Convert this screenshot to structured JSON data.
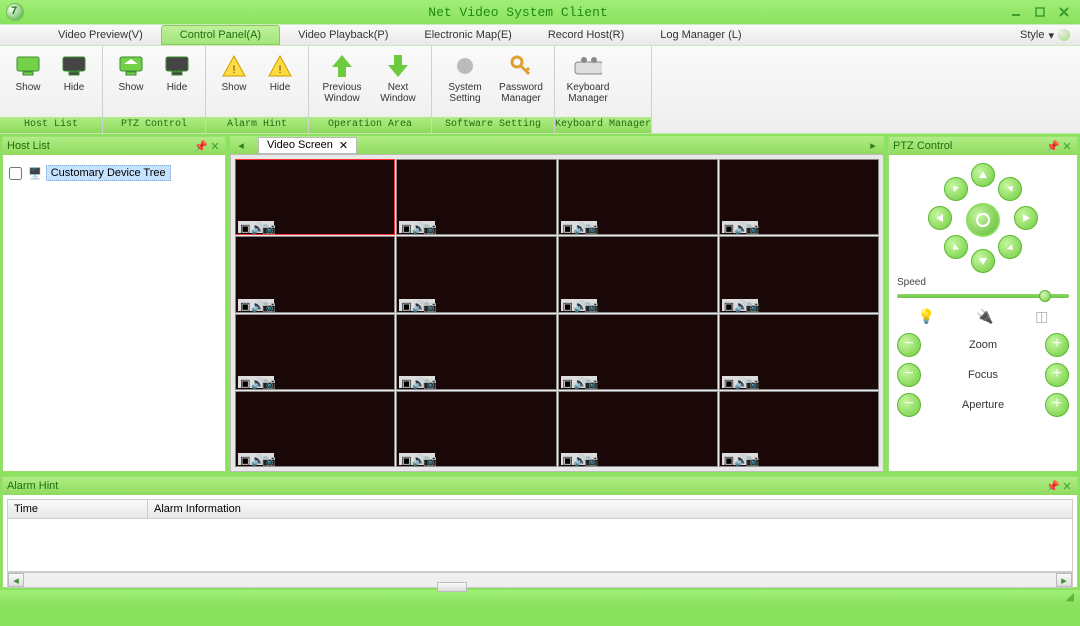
{
  "titlebar": {
    "title": "Net Video System Client"
  },
  "menu": {
    "tabs": [
      "Video Preview(V)",
      "Control Panel(A)",
      "Video Playback(P)",
      "Electronic Map(E)",
      "Record Host(R)",
      "Log Manager (L)"
    ],
    "active_index": 1,
    "style_label": "Style"
  },
  "ribbon": {
    "groups": [
      {
        "label": "Host List",
        "buttons": [
          {
            "name": "hostlist-show",
            "label": "Show",
            "icon": "monitor-green"
          },
          {
            "name": "hostlist-hide",
            "label": "Hide",
            "icon": "monitor-dark"
          }
        ]
      },
      {
        "label": "PTZ Control",
        "buttons": [
          {
            "name": "ptz-show",
            "label": "Show",
            "icon": "monitor-green-home"
          },
          {
            "name": "ptz-hide",
            "label": "Hide",
            "icon": "monitor-dark"
          }
        ]
      },
      {
        "label": "Alarm Hint",
        "buttons": [
          {
            "name": "alarm-show",
            "label": "Show",
            "icon": "warning"
          },
          {
            "name": "alarm-hide",
            "label": "Hide",
            "icon": "warning"
          }
        ]
      },
      {
        "label": "Operation Area",
        "buttons": [
          {
            "name": "prev-window",
            "label": "Previous Window",
            "icon": "arrow-up"
          },
          {
            "name": "next-window",
            "label": "Next Window",
            "icon": "arrow-down"
          }
        ]
      },
      {
        "label": "Software Setting",
        "buttons": [
          {
            "name": "system-setting",
            "label": "System Setting",
            "icon": "gear"
          },
          {
            "name": "password-manager",
            "label": "Password Manager",
            "icon": "key"
          }
        ]
      },
      {
        "label": "Keyboard Manager",
        "buttons": [
          {
            "name": "keyboard-manager",
            "label": "Keyboard Manager",
            "icon": "keyboard"
          }
        ]
      }
    ]
  },
  "hostlist": {
    "title": "Host List",
    "tree_root": "Customary Device Tree"
  },
  "center": {
    "tab_label": "Video Screen",
    "grid_rows": 4,
    "grid_cols": 4,
    "selected_cell": 0
  },
  "ptz": {
    "title": "PTZ Control",
    "speed_label": "Speed",
    "controls": [
      {
        "name": "zoom",
        "label": "Zoom"
      },
      {
        "name": "focus",
        "label": "Focus"
      },
      {
        "name": "aperture",
        "label": "Aperture"
      }
    ]
  },
  "alarm": {
    "title": "Alarm Hint",
    "columns": [
      "Time",
      "Alarm Information"
    ]
  }
}
